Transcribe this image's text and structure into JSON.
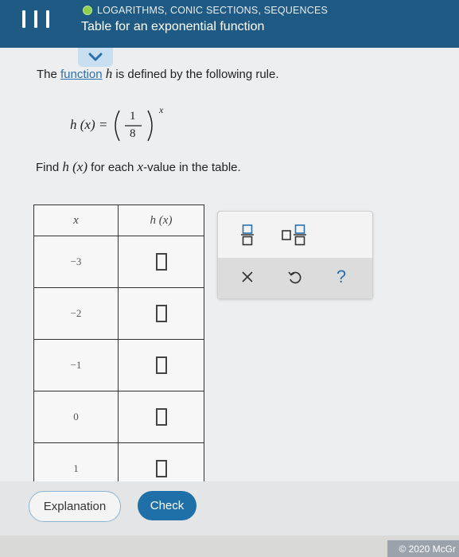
{
  "header": {
    "topic": "LOGARITHMS, CONIC SECTIONS, SEQUENCES",
    "title": "Table for an exponential function"
  },
  "problem": {
    "intro_before": "The ",
    "intro_link": "function",
    "intro_var": "h",
    "intro_after": " is defined by the following rule.",
    "formula_lhs": "h (x) =",
    "formula_num": "1",
    "formula_den": "8",
    "formula_exp": "x",
    "find_before": "Find ",
    "find_func": "h (x)",
    "find_middle": " for each ",
    "find_var": "x",
    "find_after": "-value in the table."
  },
  "table": {
    "headers": [
      "x",
      "h (x)"
    ],
    "rows": [
      {
        "x": "−3"
      },
      {
        "x": "−2"
      },
      {
        "x": "−1"
      },
      {
        "x": "0"
      },
      {
        "x": "1"
      }
    ]
  },
  "toolbar": {
    "icons": [
      "fraction-icon",
      "mixed-number-icon",
      "clear-icon",
      "undo-icon",
      "help-icon"
    ],
    "help_label": "?"
  },
  "footer": {
    "explanation_label": "Explanation",
    "check_label": "Check",
    "copyright": "© 2020 McGr"
  },
  "colors": {
    "header_bg": "#1f5a84",
    "check_button": "#1f6fa8",
    "link": "#2a6fb0",
    "status_dot": "#8fd14f"
  }
}
